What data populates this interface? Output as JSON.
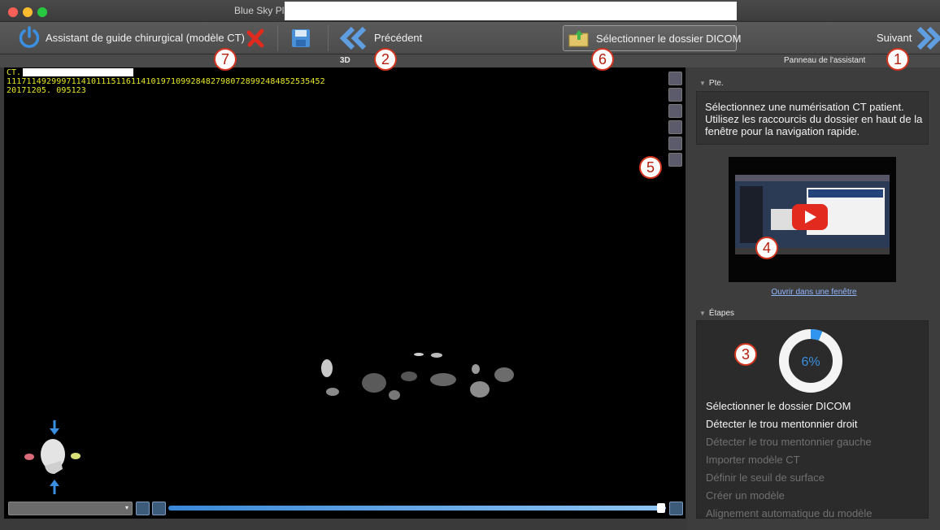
{
  "window": {
    "title": "Blue Sky Plan -"
  },
  "toolbar": {
    "wizard_label": "Assistant de guide chirurgical (modèle CT)",
    "previous_label": "Précédent",
    "select_dicom_label": "Sélectionner le dossier DICOM",
    "next_label": "Suivant"
  },
  "view": {
    "tab_label": "3D",
    "ct_prefix": "CT.",
    "ct_id_line": "111711492999711410111511611410197109928482798072899248485253545​2",
    "ct_date_line": "20171205. 095123",
    "slider_position": 0.99
  },
  "panel": {
    "tab_label": "Panneau de l'assistant",
    "tip_section": "Pte.",
    "tip_text": "Sélectionnez une numérisation CT patient. Utilisez les raccourcis du dossier en haut de la fenêtre pour la navigation rapide.",
    "video_link": "Ouvrir dans une fenêtre",
    "steps_section": "Étapes",
    "progress_percent": 6,
    "progress_label": "6%",
    "steps": [
      {
        "label": "Sélectionner le dossier DICOM",
        "state": "done"
      },
      {
        "label": "Détecter le trou mentonnier droit",
        "state": "done"
      },
      {
        "label": "Détecter le trou mentonnier gauche",
        "state": "pending"
      },
      {
        "label": "Importer modèle CT",
        "state": "pending"
      },
      {
        "label": "Définir le seuil de surface",
        "state": "pending"
      },
      {
        "label": "Créer un modèle",
        "state": "pending"
      },
      {
        "label": "Alignement automatique du modèle",
        "state": "pending"
      }
    ]
  },
  "callouts": [
    "1",
    "2",
    "3",
    "4",
    "5",
    "6",
    "7"
  ],
  "colors": {
    "accent_blue": "#3a8fe0",
    "callout_red": "#d0341e",
    "ct_text_yellow": "#e6e62a"
  }
}
